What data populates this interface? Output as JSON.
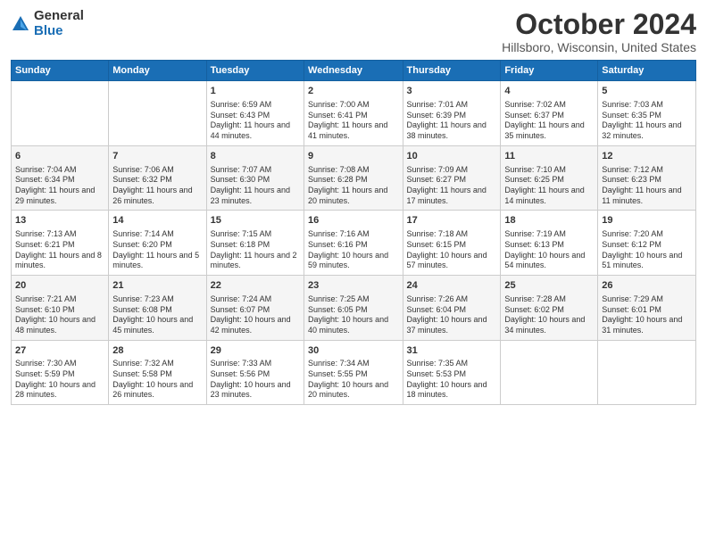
{
  "logo": {
    "general": "General",
    "blue": "Blue"
  },
  "title": "October 2024",
  "subtitle": "Hillsboro, Wisconsin, United States",
  "calendar": {
    "headers": [
      "Sunday",
      "Monday",
      "Tuesday",
      "Wednesday",
      "Thursday",
      "Friday",
      "Saturday"
    ],
    "weeks": [
      [
        {
          "day": "",
          "info": ""
        },
        {
          "day": "",
          "info": ""
        },
        {
          "day": "1",
          "info": "Sunrise: 6:59 AM\nSunset: 6:43 PM\nDaylight: 11 hours and 44 minutes."
        },
        {
          "day": "2",
          "info": "Sunrise: 7:00 AM\nSunset: 6:41 PM\nDaylight: 11 hours and 41 minutes."
        },
        {
          "day": "3",
          "info": "Sunrise: 7:01 AM\nSunset: 6:39 PM\nDaylight: 11 hours and 38 minutes."
        },
        {
          "day": "4",
          "info": "Sunrise: 7:02 AM\nSunset: 6:37 PM\nDaylight: 11 hours and 35 minutes."
        },
        {
          "day": "5",
          "info": "Sunrise: 7:03 AM\nSunset: 6:35 PM\nDaylight: 11 hours and 32 minutes."
        }
      ],
      [
        {
          "day": "6",
          "info": "Sunrise: 7:04 AM\nSunset: 6:34 PM\nDaylight: 11 hours and 29 minutes."
        },
        {
          "day": "7",
          "info": "Sunrise: 7:06 AM\nSunset: 6:32 PM\nDaylight: 11 hours and 26 minutes."
        },
        {
          "day": "8",
          "info": "Sunrise: 7:07 AM\nSunset: 6:30 PM\nDaylight: 11 hours and 23 minutes."
        },
        {
          "day": "9",
          "info": "Sunrise: 7:08 AM\nSunset: 6:28 PM\nDaylight: 11 hours and 20 minutes."
        },
        {
          "day": "10",
          "info": "Sunrise: 7:09 AM\nSunset: 6:27 PM\nDaylight: 11 hours and 17 minutes."
        },
        {
          "day": "11",
          "info": "Sunrise: 7:10 AM\nSunset: 6:25 PM\nDaylight: 11 hours and 14 minutes."
        },
        {
          "day": "12",
          "info": "Sunrise: 7:12 AM\nSunset: 6:23 PM\nDaylight: 11 hours and 11 minutes."
        }
      ],
      [
        {
          "day": "13",
          "info": "Sunrise: 7:13 AM\nSunset: 6:21 PM\nDaylight: 11 hours and 8 minutes."
        },
        {
          "day": "14",
          "info": "Sunrise: 7:14 AM\nSunset: 6:20 PM\nDaylight: 11 hours and 5 minutes."
        },
        {
          "day": "15",
          "info": "Sunrise: 7:15 AM\nSunset: 6:18 PM\nDaylight: 11 hours and 2 minutes."
        },
        {
          "day": "16",
          "info": "Sunrise: 7:16 AM\nSunset: 6:16 PM\nDaylight: 10 hours and 59 minutes."
        },
        {
          "day": "17",
          "info": "Sunrise: 7:18 AM\nSunset: 6:15 PM\nDaylight: 10 hours and 57 minutes."
        },
        {
          "day": "18",
          "info": "Sunrise: 7:19 AM\nSunset: 6:13 PM\nDaylight: 10 hours and 54 minutes."
        },
        {
          "day": "19",
          "info": "Sunrise: 7:20 AM\nSunset: 6:12 PM\nDaylight: 10 hours and 51 minutes."
        }
      ],
      [
        {
          "day": "20",
          "info": "Sunrise: 7:21 AM\nSunset: 6:10 PM\nDaylight: 10 hours and 48 minutes."
        },
        {
          "day": "21",
          "info": "Sunrise: 7:23 AM\nSunset: 6:08 PM\nDaylight: 10 hours and 45 minutes."
        },
        {
          "day": "22",
          "info": "Sunrise: 7:24 AM\nSunset: 6:07 PM\nDaylight: 10 hours and 42 minutes."
        },
        {
          "day": "23",
          "info": "Sunrise: 7:25 AM\nSunset: 6:05 PM\nDaylight: 10 hours and 40 minutes."
        },
        {
          "day": "24",
          "info": "Sunrise: 7:26 AM\nSunset: 6:04 PM\nDaylight: 10 hours and 37 minutes."
        },
        {
          "day": "25",
          "info": "Sunrise: 7:28 AM\nSunset: 6:02 PM\nDaylight: 10 hours and 34 minutes."
        },
        {
          "day": "26",
          "info": "Sunrise: 7:29 AM\nSunset: 6:01 PM\nDaylight: 10 hours and 31 minutes."
        }
      ],
      [
        {
          "day": "27",
          "info": "Sunrise: 7:30 AM\nSunset: 5:59 PM\nDaylight: 10 hours and 28 minutes."
        },
        {
          "day": "28",
          "info": "Sunrise: 7:32 AM\nSunset: 5:58 PM\nDaylight: 10 hours and 26 minutes."
        },
        {
          "day": "29",
          "info": "Sunrise: 7:33 AM\nSunset: 5:56 PM\nDaylight: 10 hours and 23 minutes."
        },
        {
          "day": "30",
          "info": "Sunrise: 7:34 AM\nSunset: 5:55 PM\nDaylight: 10 hours and 20 minutes."
        },
        {
          "day": "31",
          "info": "Sunrise: 7:35 AM\nSunset: 5:53 PM\nDaylight: 10 hours and 18 minutes."
        },
        {
          "day": "",
          "info": ""
        },
        {
          "day": "",
          "info": ""
        }
      ]
    ]
  }
}
